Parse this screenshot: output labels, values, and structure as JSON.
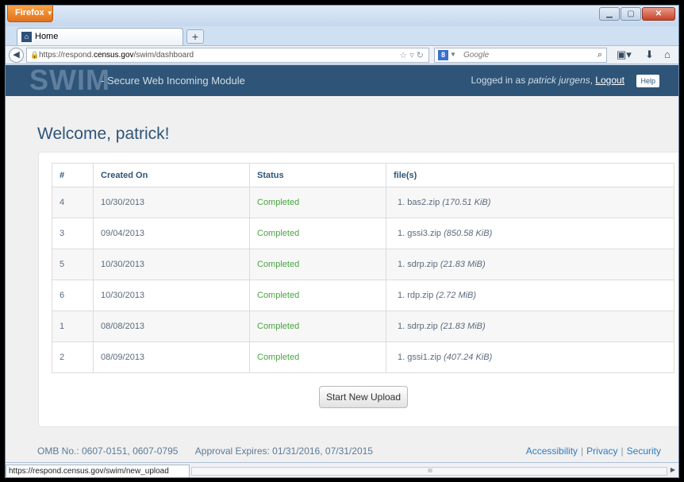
{
  "browser": {
    "menu_label": "Firefox",
    "tab_title": "Home",
    "new_tab_label": "+",
    "url_prefix": "https://respond.",
    "url_domain": "census.gov",
    "url_path": "/swim/dashboard",
    "search_placeholder": "Google",
    "status_url": "https://respond.census.gov/swim/new_upload",
    "scroll_grip": "III"
  },
  "app": {
    "logo": "SWIM",
    "subtitle": "- Secure Web Incoming Module",
    "logged_in_prefix": "Logged in as",
    "user_name": "patrick jurgens",
    "logout_label": "Logout",
    "help_label": "Help",
    "welcome": "Welcome, patrick!"
  },
  "table": {
    "headers": [
      "#",
      "Created On",
      "Status",
      "file(s)"
    ],
    "rows": [
      {
        "id": "4",
        "created": "10/30/2013",
        "status": "Completed",
        "file": "1. bas2.zip",
        "size": "(170.51 KiB)"
      },
      {
        "id": "3",
        "created": "09/04/2013",
        "status": "Completed",
        "file": "1. gssi3.zip",
        "size": "(850.58 KiB)"
      },
      {
        "id": "5",
        "created": "10/30/2013",
        "status": "Completed",
        "file": "1. sdrp.zip",
        "size": "(21.83 MiB)"
      },
      {
        "id": "6",
        "created": "10/30/2013",
        "status": "Completed",
        "file": "1. rdp.zip",
        "size": "(2.72 MiB)"
      },
      {
        "id": "1",
        "created": "08/08/2013",
        "status": "Completed",
        "file": "1. sdrp.zip",
        "size": "(21.83 MiB)"
      },
      {
        "id": "2",
        "created": "08/09/2013",
        "status": "Completed",
        "file": "1. gssi1.zip",
        "size": "(407.24 KiB)"
      }
    ]
  },
  "actions": {
    "start_upload": "Start New Upload"
  },
  "footer": {
    "omb": "OMB No.: 0607-0151, 0607-0795",
    "approval": "Approval Expires: 01/31/2016, 07/31/2015",
    "links": [
      "Accessibility",
      "Privacy",
      "Security"
    ],
    "separator": "|"
  }
}
